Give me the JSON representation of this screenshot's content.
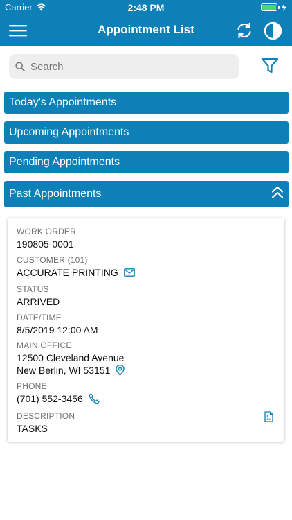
{
  "status_bar": {
    "carrier": "Carrier",
    "time": "2:48 PM"
  },
  "header": {
    "title": "Appointment List"
  },
  "search": {
    "placeholder": "Search"
  },
  "sections": [
    {
      "label": "Today's Appointments"
    },
    {
      "label": "Upcoming Appointments"
    },
    {
      "label": "Pending Appointments"
    },
    {
      "label": "Past Appointments"
    }
  ],
  "appointment": {
    "work_order_label": "WORK ORDER",
    "work_order": "190805-0001",
    "customer_label": "CUSTOMER (101)",
    "customer": "ACCURATE PRINTING",
    "status_label": "STATUS",
    "status": "ARRIVED",
    "datetime_label": "DATE/TIME",
    "datetime": "8/5/2019 12:00 AM",
    "office_label": "MAIN OFFICE",
    "address_line1": "12500 Cleveland Avenue",
    "address_line2": "New Berlin, WI 53151",
    "phone_label": "PHONE",
    "phone": "(701) 552-3456",
    "description_label": "DESCRIPTION",
    "description": "TASKS"
  },
  "colors": {
    "primary": "#0d80b8",
    "battery": "#4cd964",
    "search_bg": "#eeeeee"
  },
  "icons": {
    "menu": "hamburger-icon",
    "refresh": "refresh-icon",
    "theme": "contrast-icon",
    "search": "search-icon",
    "filter": "filter-icon",
    "collapse": "chevron-double-up-icon",
    "email": "envelope-icon",
    "location": "map-pin-icon",
    "phone": "phone-icon",
    "document": "document-icon"
  }
}
